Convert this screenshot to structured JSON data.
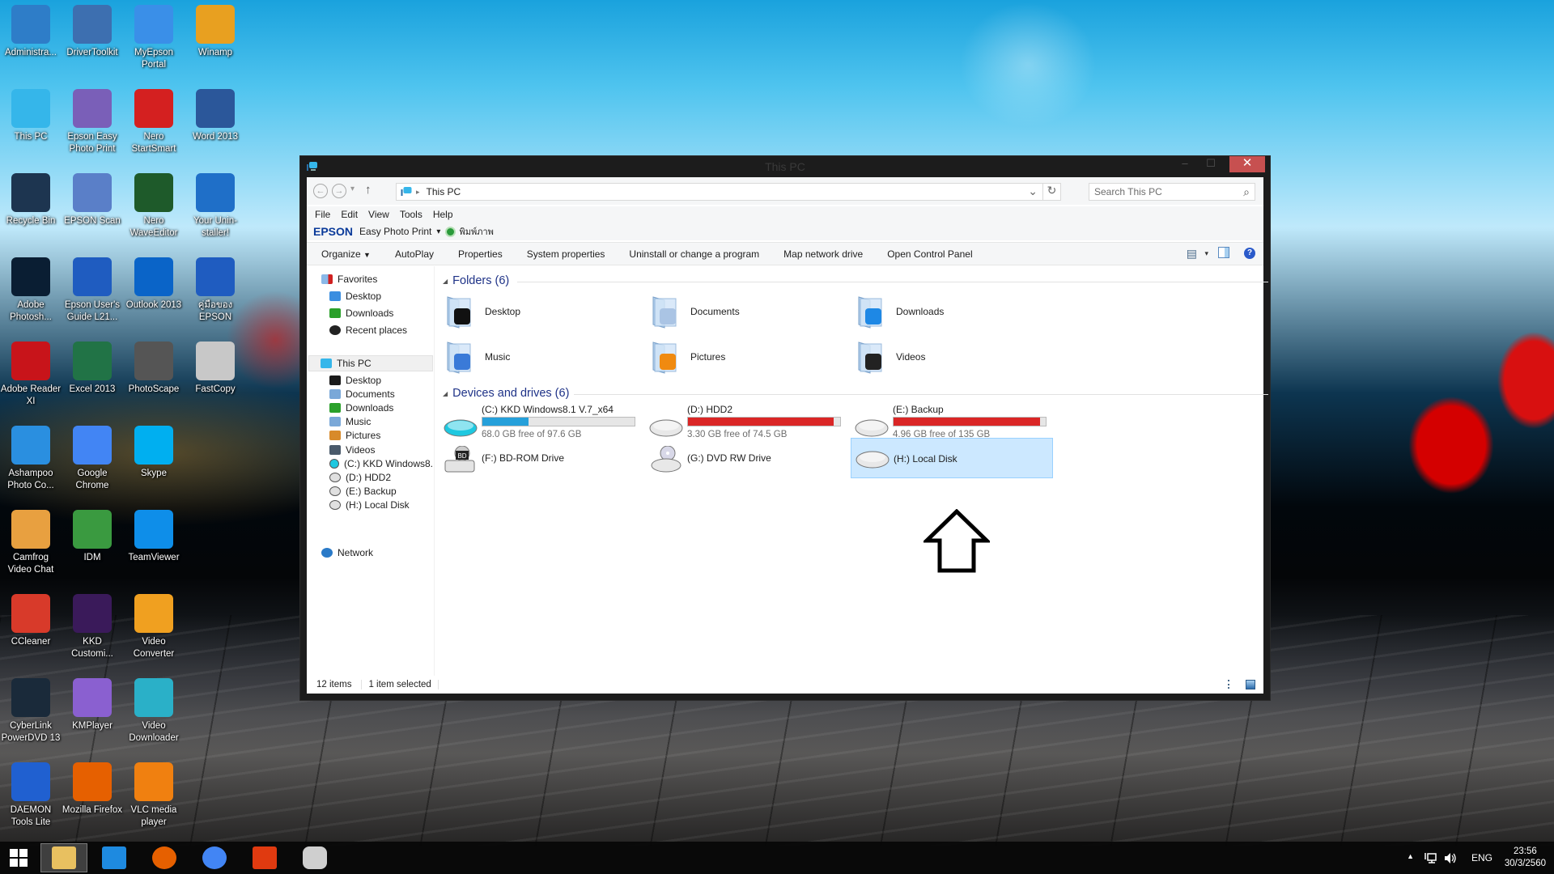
{
  "desktop": {
    "icons": [
      {
        "label": "Administra...",
        "icon": "user-folder-icon",
        "color": "#2e7dc8"
      },
      {
        "label": "DriverToolkit",
        "icon": "wrench-hammer-icon",
        "color": "#3d6fb0"
      },
      {
        "label": "MyEpson Portal",
        "icon": "info-bubble-icon",
        "color": "#3a8fe8"
      },
      {
        "label": "Winamp",
        "icon": "winamp-icon",
        "color": "#e8a020"
      },
      {
        "label": "This PC",
        "icon": "computer-icon",
        "color": "#35b6ea"
      },
      {
        "label": "Epson Easy Photo Print",
        "icon": "photo-print-icon",
        "color": "#7a5fb8"
      },
      {
        "label": "Nero StartSmart",
        "icon": "nero-flame-icon",
        "color": "#d42020"
      },
      {
        "label": "Word 2013",
        "icon": "word-icon",
        "color": "#2b579a"
      },
      {
        "label": "Recycle Bin",
        "icon": "recycle-bin-icon",
        "color": "#1d3550"
      },
      {
        "label": "EPSON Scan",
        "icon": "scanner-icon",
        "color": "#5a7fc8"
      },
      {
        "label": "Nero WaveEditor",
        "icon": "waveform-icon",
        "color": "#1e5a2a"
      },
      {
        "label": "Your Unin-staller!",
        "icon": "uninstaller-icon",
        "color": "#1f6fc8"
      },
      {
        "label": "Adobe Photosh...",
        "icon": "photoshop-icon",
        "color": "#0a1e33"
      },
      {
        "label": "Epson User's Guide L21...",
        "icon": "guide-book-icon",
        "color": "#1f5cc0"
      },
      {
        "label": "Outlook 2013",
        "icon": "outlook-icon",
        "color": "#0a64c8"
      },
      {
        "label": "คู่มือของ EPSON",
        "icon": "guide-book-icon",
        "color": "#1f5cc0"
      },
      {
        "label": "Adobe Reader XI",
        "icon": "pdf-icon",
        "color": "#c8141a"
      },
      {
        "label": "Excel 2013",
        "icon": "excel-icon",
        "color": "#217346"
      },
      {
        "label": "PhotoScape",
        "icon": "photoscape-icon",
        "color": "#555555"
      },
      {
        "label": "FastCopy",
        "icon": "fastcopy-icon",
        "color": "#c8c8c8"
      },
      {
        "label": "Ashampoo Photo Co...",
        "icon": "ashampoo-icon",
        "color": "#2a8fe0"
      },
      {
        "label": "Google Chrome",
        "icon": "chrome-icon",
        "color": "#4285f4"
      },
      {
        "label": "Skype",
        "icon": "skype-icon",
        "color": "#00aff0"
      },
      {
        "label": "Camfrog Video Chat",
        "icon": "camfrog-icon",
        "color": "#e8a040"
      },
      {
        "label": "IDM",
        "icon": "idm-globe-icon",
        "color": "#3a9a40"
      },
      {
        "label": "TeamViewer",
        "icon": "teamviewer-icon",
        "color": "#0e8ee9"
      },
      {
        "label": "CCleaner",
        "icon": "ccleaner-icon",
        "color": "#d83a2a"
      },
      {
        "label": "KKD Customi...",
        "icon": "magic-wand-icon",
        "color": "#3a1a5a"
      },
      {
        "label": "Video Converter",
        "icon": "video-converter-icon",
        "color": "#f0a020"
      },
      {
        "label": "CyberLink PowerDVD 13",
        "icon": "play-disc-icon",
        "color": "#1a2a3a"
      },
      {
        "label": "KMPlayer",
        "icon": "kmplayer-icon",
        "color": "#8a60d0"
      },
      {
        "label": "Video Downloader",
        "icon": "download-diamond-icon",
        "color": "#2ab0c8"
      },
      {
        "label": "DAEMON Tools Lite",
        "icon": "lightning-icon",
        "color": "#2060d0"
      },
      {
        "label": "Mozilla Firefox",
        "icon": "firefox-icon",
        "color": "#e66000"
      },
      {
        "label": "VLC media player",
        "icon": "vlc-cone-icon",
        "color": "#f08010"
      }
    ]
  },
  "window": {
    "title": "This PC",
    "minimize": "–",
    "maximize": "☐",
    "close": "✕",
    "nav": {
      "back": "←",
      "forward": "→",
      "recent": "▾",
      "up": "↑"
    },
    "address": {
      "icon": "this-pc-icon",
      "separator": "▸",
      "path": "This PC",
      "dropdown": "⌄",
      "refresh": "↻"
    },
    "search": {
      "placeholder": "Search This PC",
      "icon": "⌕"
    },
    "menu": [
      "File",
      "Edit",
      "View",
      "Tools",
      "Help"
    ],
    "epson_bar": {
      "brand": "EPSON",
      "app": "Easy Photo Print",
      "dropdown": "▾",
      "print_label": "พิมพ์ภาพ"
    },
    "commands": [
      {
        "label": "Organize",
        "has_dropdown": true
      },
      {
        "label": "AutoPlay"
      },
      {
        "label": "Properties"
      },
      {
        "label": "System properties"
      },
      {
        "label": "Uninstall or change a program"
      },
      {
        "label": "Map network drive"
      },
      {
        "label": "Open Control Panel"
      }
    ],
    "view_controls": {
      "change_view": "▤",
      "dropdown": "▾",
      "preview_pane": "◫",
      "help": "?"
    },
    "nav_pane": {
      "favorites": {
        "label": "Favorites",
        "items": [
          "Desktop",
          "Downloads",
          "Recent places"
        ]
      },
      "this_pc": {
        "label": "This PC",
        "items": [
          "Desktop",
          "Documents",
          "Downloads",
          "Music",
          "Pictures",
          "Videos",
          "(C:) KKD Windows8.",
          "(D:) HDD2",
          "(E:) Backup",
          "(H:) Local Disk"
        ]
      },
      "network": {
        "label": "Network"
      }
    },
    "folders": {
      "header": "Folders (6)",
      "items": [
        {
          "name": "Desktop",
          "icon": "desktop-folder-icon"
        },
        {
          "name": "Documents",
          "icon": "documents-folder-icon"
        },
        {
          "name": "Downloads",
          "icon": "downloads-folder-icon"
        },
        {
          "name": "Music",
          "icon": "music-folder-icon"
        },
        {
          "name": "Pictures",
          "icon": "pictures-folder-icon"
        },
        {
          "name": "Videos",
          "icon": "videos-folder-icon"
        }
      ]
    },
    "drives": {
      "header": "Devices and drives (6)",
      "items": [
        {
          "name": "(C:) KKD Windows8.1 V.7_x64",
          "free": "68.0 GB free of 97.6 GB",
          "used_fraction": 0.303,
          "bar_color": "#26a0da",
          "icon": "system-drive-icon"
        },
        {
          "name": "(D:) HDD2",
          "free": "3.30 GB free of 74.5 GB",
          "used_fraction": 0.956,
          "bar_color": "#da2626",
          "icon": "hard-drive-icon"
        },
        {
          "name": "(E:) Backup",
          "free": "4.96 GB free of 135 GB",
          "used_fraction": 0.963,
          "bar_color": "#da2626",
          "icon": "hard-drive-icon"
        },
        {
          "name": "(F:) BD-ROM Drive",
          "icon": "bd-rom-drive-icon"
        },
        {
          "name": "(G:) DVD RW Drive",
          "icon": "dvd-drive-icon"
        },
        {
          "name": "(H:) Local Disk",
          "icon": "hard-drive-icon",
          "selected": true
        }
      ]
    },
    "annotation_arrow": "up-arrow-annotation",
    "status": {
      "items": "12 items",
      "selected": "1 item selected"
    }
  },
  "taskbar": {
    "start": "start-button",
    "pinned": [
      {
        "name": "File Explorer",
        "icon": "file-explorer-icon",
        "active": true
      },
      {
        "name": "Internet Explorer",
        "icon": "internet-explorer-icon"
      },
      {
        "name": "Firefox",
        "icon": "firefox-icon"
      },
      {
        "name": "Chrome",
        "icon": "chrome-icon"
      },
      {
        "name": "Office",
        "icon": "office-icon"
      },
      {
        "name": "USB Drive",
        "icon": "usb-drive-icon"
      }
    ],
    "tray": {
      "show_hidden": "▲",
      "language": "ENG",
      "time": "23:56",
      "date": "30/3/2560"
    }
  }
}
